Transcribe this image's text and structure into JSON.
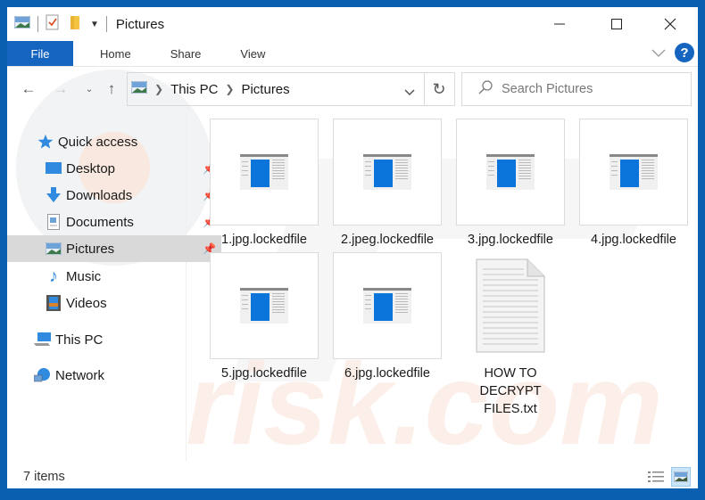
{
  "window": {
    "title": "Pictures",
    "controls": {
      "minimize": "minimize-icon",
      "maximize": "maximize-icon",
      "close": "close-icon"
    }
  },
  "ribbon": {
    "tabs": [
      {
        "label": "File",
        "active": true
      },
      {
        "label": "Home"
      },
      {
        "label": "Share"
      },
      {
        "label": "View"
      }
    ],
    "help_label": "?"
  },
  "navigation": {
    "breadcrumb": [
      "This PC",
      "Pictures"
    ],
    "search_placeholder": "Search Pictures"
  },
  "sidebar": {
    "items": [
      {
        "label": "Quick access",
        "icon": "star-icon",
        "level": 0
      },
      {
        "label": "Desktop",
        "icon": "desktop-icon",
        "level": 1,
        "pinned": true
      },
      {
        "label": "Downloads",
        "icon": "download-icon",
        "level": 1,
        "pinned": true
      },
      {
        "label": "Documents",
        "icon": "documents-icon",
        "level": 1,
        "pinned": true
      },
      {
        "label": "Pictures",
        "icon": "pictures-icon",
        "level": 1,
        "pinned": true,
        "selected": true
      },
      {
        "label": "Music",
        "icon": "music-icon",
        "level": 1
      },
      {
        "label": "Videos",
        "icon": "videos-icon",
        "level": 1
      },
      {
        "label": "This PC",
        "icon": "computer-icon",
        "level": 0
      },
      {
        "label": "Network",
        "icon": "network-icon",
        "level": 0
      }
    ]
  },
  "files": [
    {
      "name": "1.jpg.lockedfile",
      "type": "image"
    },
    {
      "name": "2.jpeg.lockedfile",
      "type": "image"
    },
    {
      "name": "3.jpg.lockedfile",
      "type": "image"
    },
    {
      "name": "4.jpg.lockedfile",
      "type": "image"
    },
    {
      "name": "5.jpg.lockedfile",
      "type": "image"
    },
    {
      "name": "6.jpg.lockedfile",
      "type": "image"
    },
    {
      "name": "HOW TO DECRYPT FILES.txt",
      "type": "text",
      "lines": [
        "HOW TO",
        "DECRYPT",
        "FILES.txt"
      ]
    }
  ],
  "status": {
    "item_count": "7 items"
  },
  "colors": {
    "accent": "#1565c0",
    "frame": "#0a5fb0",
    "selected_bg": "#d9d9d9"
  }
}
